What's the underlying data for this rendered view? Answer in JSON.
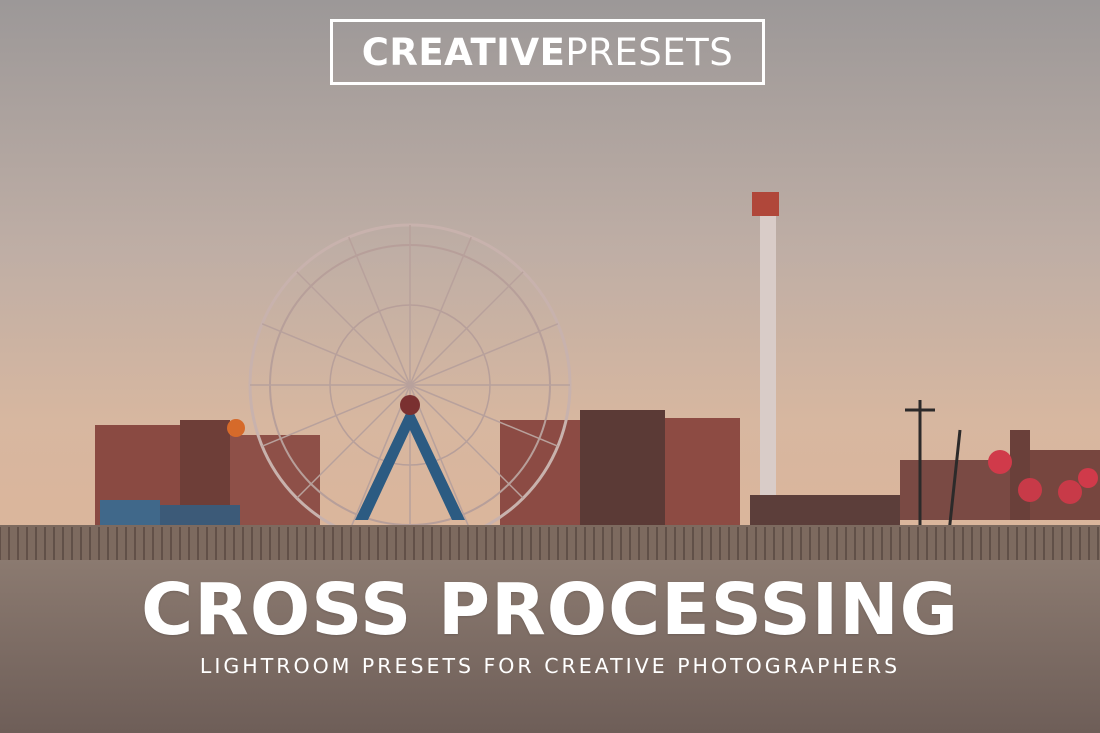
{
  "logo": {
    "bold_part": "CREATIVE",
    "light_part": "PRESETS"
  },
  "headline": "CROSS PROCESSING",
  "subheadline": "LIGHTROOM PRESETS FOR CREATIVE PHOTOGRAPHERS",
  "colors": {
    "sky_top": "#9e9a99",
    "sky_mid": "#c7b2a6",
    "sky_horizon": "#dcb79e",
    "sand": "#7c6c66",
    "text": "#ffffff",
    "wheel_frame": "#c9b3ae",
    "wheel_tower": "#2c5b82",
    "tower": "#d9cbc6",
    "tower_top": "#b0473a",
    "buildings": "#8c4b42"
  }
}
